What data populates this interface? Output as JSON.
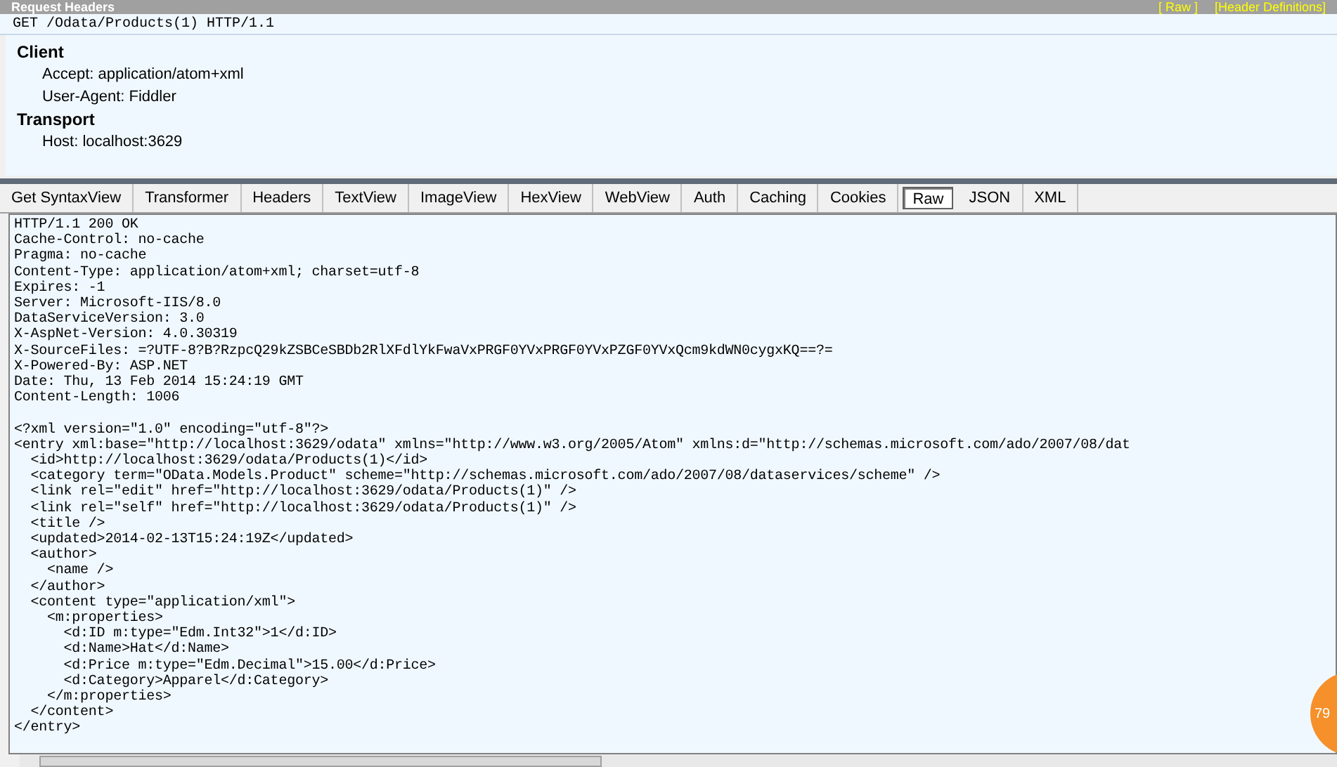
{
  "request_panel": {
    "title": "Request Headers",
    "links": [
      "[ Raw ]",
      "[Header Definitions]"
    ],
    "request_line": "GET /Odata/Products(1) HTTP/1.1",
    "groups": [
      {
        "name": "Client",
        "headers": [
          "Accept: application/atom+xml",
          "User-Agent: Fiddler"
        ]
      },
      {
        "name": "Transport",
        "headers": [
          "Host: localhost:3629"
        ]
      }
    ]
  },
  "tabs": [
    {
      "label": "Get SyntaxView",
      "selected": false
    },
    {
      "label": "Transformer",
      "selected": false
    },
    {
      "label": "Headers",
      "selected": false
    },
    {
      "label": "TextView",
      "selected": false
    },
    {
      "label": "ImageView",
      "selected": false
    },
    {
      "label": "HexView",
      "selected": false
    },
    {
      "label": "WebView",
      "selected": false
    },
    {
      "label": "Auth",
      "selected": false
    },
    {
      "label": "Caching",
      "selected": false
    },
    {
      "label": "Cookies",
      "selected": false
    },
    {
      "label": "Raw",
      "selected": true
    },
    {
      "label": "JSON",
      "selected": false
    },
    {
      "label": "XML",
      "selected": false
    }
  ],
  "response_headers": [
    "HTTP/1.1 200 OK",
    "Cache-Control: no-cache",
    "Pragma: no-cache",
    "Content-Type: application/atom+xml; charset=utf-8",
    "Expires: -1",
    "Server: Microsoft-IIS/8.0",
    "DataServiceVersion: 3.0",
    "X-AspNet-Version: 4.0.30319",
    "X-SourceFiles: =?UTF-8?B?RzpcQ29kZSBCeSBDb2RlXFdlYkFwaVxPRGF0YVxPRGF0YVxPZGF0YVxQcm9kdWN0cygxKQ==?=",
    "X-Powered-By: ASP.NET",
    "Date: Thu, 13 Feb 2014 15:24:19 GMT",
    "Content-Length: 1006"
  ],
  "response_body": [
    "<?xml version=\"1.0\" encoding=\"utf-8\"?>",
    "<entry xml:base=\"http://localhost:3629/odata\" xmlns=\"http://www.w3.org/2005/Atom\" xmlns:d=\"http://schemas.microsoft.com/ado/2007/08/dat",
    "  <id>http://localhost:3629/odata/Products(1)</id>",
    "  <category term=\"OData.Models.Product\" scheme=\"http://schemas.microsoft.com/ado/2007/08/dataservices/scheme\" />",
    "  <link rel=\"edit\" href=\"http://localhost:3629/odata/Products(1)\" />",
    "  <link rel=\"self\" href=\"http://localhost:3629/odata/Products(1)\" />",
    "  <title />",
    "  <updated>2014-02-13T15:24:19Z</updated>",
    "  <author>",
    "    <name />",
    "  </author>",
    "  <content type=\"application/xml\">",
    "    <m:properties>",
    "      <d:ID m:type=\"Edm.Int32\">1</d:ID>",
    "      <d:Name>Hat</d:Name>",
    "      <d:Price m:type=\"Edm.Decimal\">15.00</d:Price>",
    "      <d:Category>Apparel</d:Category>",
    "    </m:properties>",
    "  </content>",
    "</entry>"
  ],
  "overlay_badge": "79"
}
